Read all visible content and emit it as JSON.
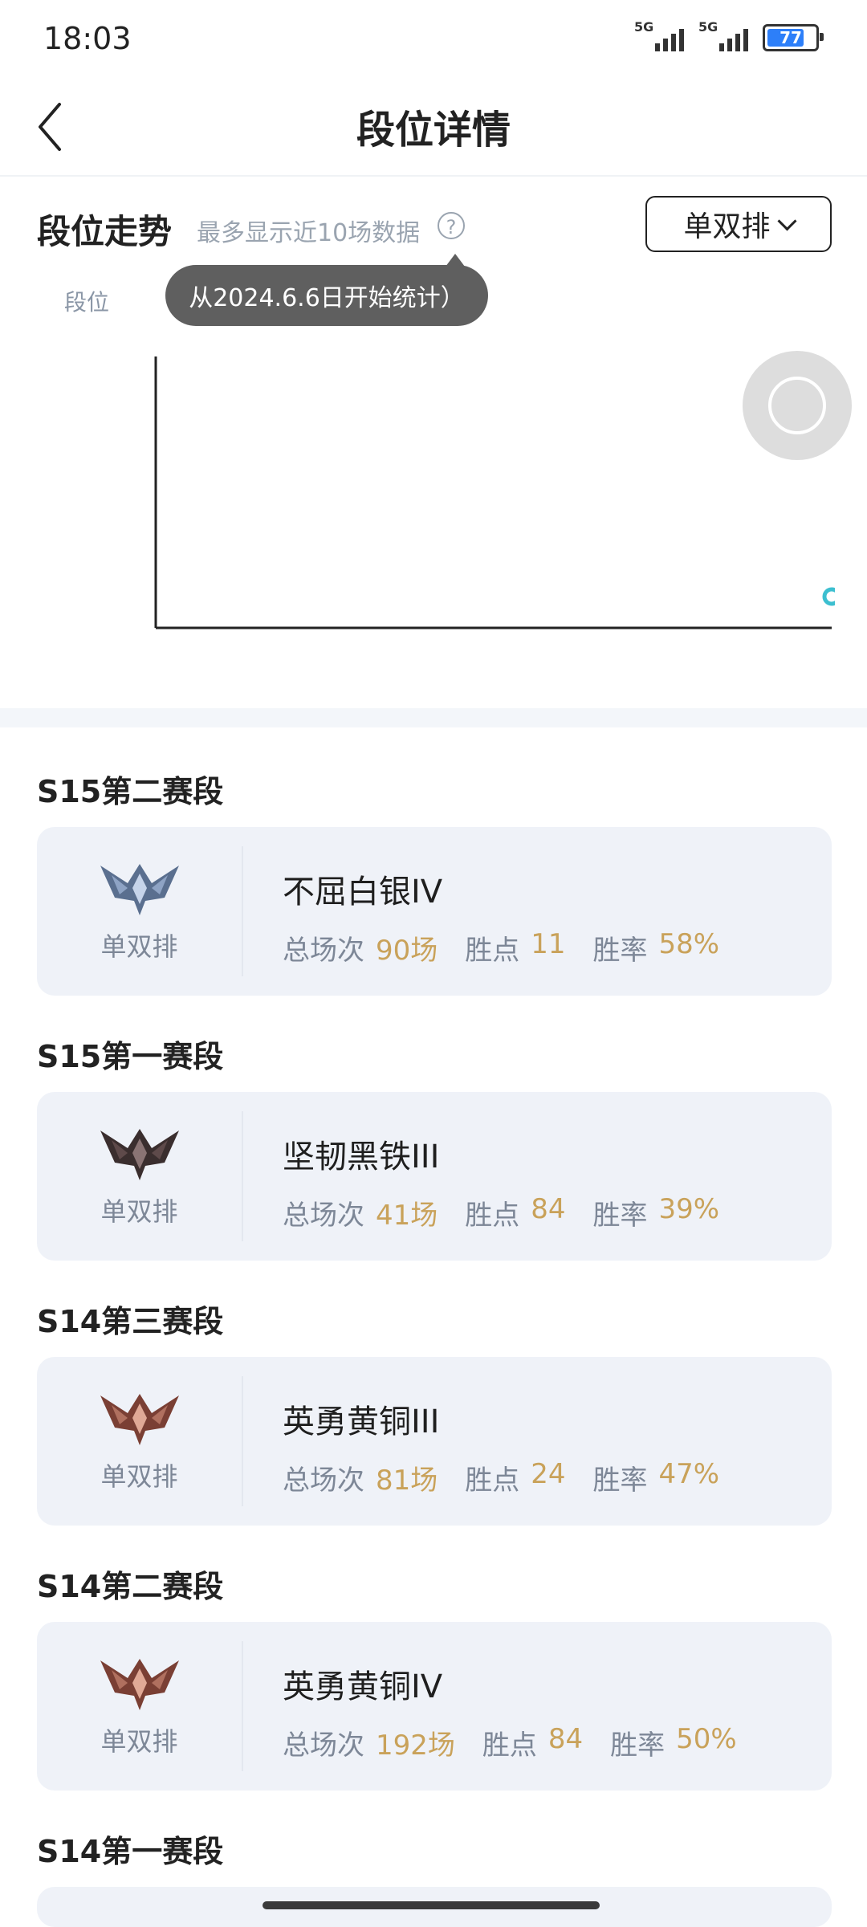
{
  "status_bar": {
    "time": "18:03",
    "signal1_tag": "5G",
    "signal2_tag": "5G",
    "battery": "77"
  },
  "header": {
    "title": "段位详情"
  },
  "trend": {
    "title": "段位走势",
    "hint": "最多显示近10场数据",
    "help_symbol": "?",
    "tooltip": "从2024.6.6日开始统计）",
    "axis_label": "段位",
    "queue_select": "单双排"
  },
  "colors": {
    "accent_value": "#c9a25a",
    "card_bg": "#eff2f8",
    "data_point": "#3cbfd0"
  },
  "seasons": [
    {
      "title": "S15第二赛段",
      "queue": "单双排",
      "rank": "不屈白银IV",
      "emblem": "silver-emblem-icon",
      "stats": [
        {
          "label": "总场次",
          "value": "90场"
        },
        {
          "label": "胜点",
          "value": "11"
        },
        {
          "label": "胜率",
          "value": "58%"
        }
      ]
    },
    {
      "title": "S15第一赛段",
      "queue": "单双排",
      "rank": "坚韧黑铁III",
      "emblem": "iron-emblem-icon",
      "stats": [
        {
          "label": "总场次",
          "value": "41场"
        },
        {
          "label": "胜点",
          "value": "84"
        },
        {
          "label": "胜率",
          "value": "39%"
        }
      ]
    },
    {
      "title": "S14第三赛段",
      "queue": "单双排",
      "rank": "英勇黄铜III",
      "emblem": "bronze-emblem-icon",
      "stats": [
        {
          "label": "总场次",
          "value": "81场"
        },
        {
          "label": "胜点",
          "value": "24"
        },
        {
          "label": "胜率",
          "value": "47%"
        }
      ]
    },
    {
      "title": "S14第二赛段",
      "queue": "单双排",
      "rank": "英勇黄铜IV",
      "emblem": "bronze-emblem-icon",
      "stats": [
        {
          "label": "总场次",
          "value": "192场"
        },
        {
          "label": "胜点",
          "value": "84"
        },
        {
          "label": "胜率",
          "value": "50%"
        }
      ]
    },
    {
      "title": "S14第一赛段"
    }
  ]
}
